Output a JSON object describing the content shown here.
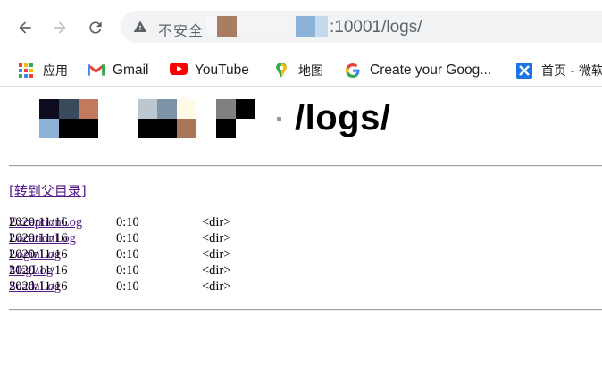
{
  "toolbar": {
    "insecure_label": "不安全",
    "url_suffix": ":10001/logs/"
  },
  "bookmarks": [
    {
      "label": "应用",
      "icon": "apps-grid-icon"
    },
    {
      "label": "Gmail",
      "icon": "gmail-icon"
    },
    {
      "label": "YouTube",
      "icon": "youtube-icon"
    },
    {
      "label": "地图",
      "icon": "maps-icon"
    },
    {
      "label": "Create your Goog...",
      "icon": "google-icon"
    },
    {
      "label": "首页 - 微软",
      "icon": "x-app-icon"
    }
  ],
  "page": {
    "heading_suffix": "/logs/",
    "parent_link": "[转到父目录]",
    "entries": [
      {
        "date": "2020/11/16",
        "time": "0:10",
        "kind": "<dir>",
        "name": "ExceptionLog"
      },
      {
        "date": "2020/11/16",
        "time": "0:10",
        "kind": "<dir>",
        "name": "LocationLog"
      },
      {
        "date": "2020/11/16",
        "time": "0:10",
        "kind": "<dir>",
        "name": "LoginLog"
      },
      {
        "date": "2020/11/16",
        "time": "0:10",
        "kind": "<dir>",
        "name": "MsgLog"
      },
      {
        "date": "2020/11/16",
        "time": "0:10",
        "kind": "<dir>",
        "name": "ScadaLog"
      }
    ]
  },
  "colors": {
    "link_visited": "#551a8b",
    "omnibox_bg": "#f1f3f4",
    "youtube_red": "#ff0000",
    "x_app_blue": "#1a73e8"
  }
}
